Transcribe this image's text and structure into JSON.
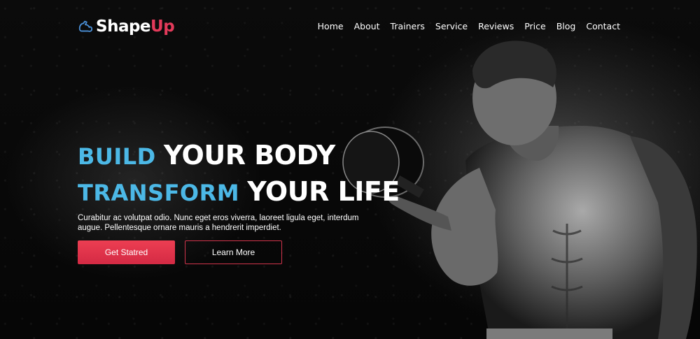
{
  "logo": {
    "part1": "Shape",
    "part2": "Up",
    "icon": "flexed-arm-icon",
    "accent_color": "#e33a5a"
  },
  "nav": {
    "items": [
      "Home",
      "About",
      "Trainers",
      "Service",
      "Reviews",
      "Price",
      "Blog",
      "Contact"
    ]
  },
  "hero": {
    "line1_accent": "BUILD",
    "line1_main": "YOUR BODY",
    "line2_accent": "TRANSFORM",
    "line2_main": "YOUR LIFE",
    "description": "Curabitur ac volutpat odio. Nunc eget eros viverra, laoreet ligula eget, interdum augue. Pellentesque ornare mauris a hendrerit imperdiet.",
    "primary_button": "Get Statred",
    "secondary_button": "Learn More",
    "accent_color": "#4cb8e6",
    "button_color": "#e0334c"
  }
}
